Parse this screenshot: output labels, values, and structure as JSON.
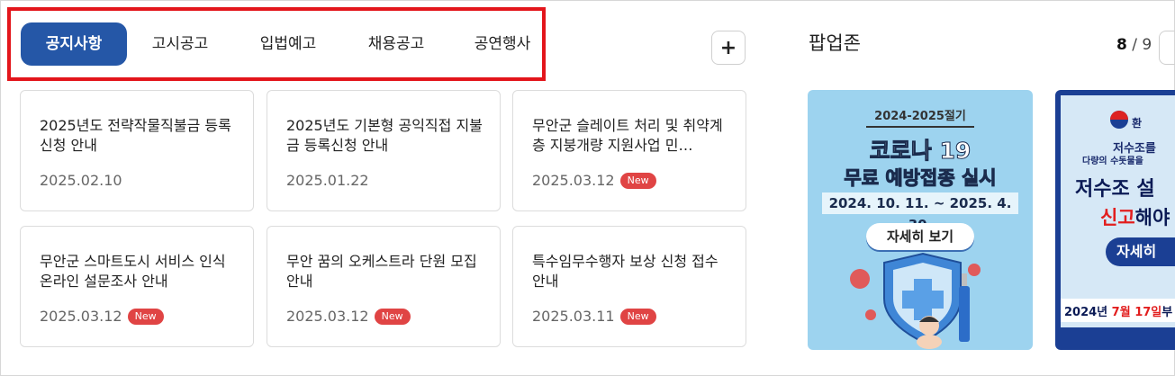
{
  "tabs": [
    {
      "label": "공지사항",
      "active": true
    },
    {
      "label": "고시공고",
      "active": false
    },
    {
      "label": "입법예고",
      "active": false
    },
    {
      "label": "채용공고",
      "active": false
    },
    {
      "label": "공연행사",
      "active": false
    }
  ],
  "more_button": "+",
  "notices": [
    {
      "title": "2025년도 전략작물직불금 등록신청 안내",
      "date": "2025.02.10",
      "badge": ""
    },
    {
      "title": "2025년도 기본형 공익직접 지불금 등록신청 안내",
      "date": "2025.01.22",
      "badge": ""
    },
    {
      "title": "무안군 슬레이트 처리 및 취약계층 지붕개량 지원사업 민…",
      "date": "2025.03.12",
      "badge": "New"
    },
    {
      "title": "무안군 스마트도시 서비스 인식 온라인 설문조사 안내",
      "date": "2025.03.12",
      "badge": "New"
    },
    {
      "title": "무안 꿈의 오케스트라 단원 모집 안내",
      "date": "2025.03.12",
      "badge": "New"
    },
    {
      "title": "특수임무수행자 보상 신청 접수 안내",
      "date": "2025.03.11",
      "badge": "New"
    }
  ],
  "popup_zone": {
    "title": "팝업존",
    "current": "8",
    "separator": "/",
    "total": "9"
  },
  "banner1": {
    "season": "2024-2025절기",
    "headline": "코로나 19",
    "subhead": "무료 예방접종 실시",
    "period": "2024. 10. 11. ~ 2025. 4. 30.",
    "button": "자세히 보기"
  },
  "banner2": {
    "org": "환",
    "line1": "저수조를",
    "line2": "다량의 수돗물을",
    "line3": "저수조 설",
    "line4_red": "신고",
    "line4_navy": "해야",
    "button": "자세히",
    "date_prefix": "2024년 ",
    "date_red": "7월 17일",
    "date_suffix": "부"
  },
  "colors": {
    "active_tab": "#2557a7",
    "highlight_border": "#e3151b",
    "badge": "#e04444",
    "banner1_bg": "#9dd3ef",
    "banner2_frame": "#1b3f94"
  }
}
